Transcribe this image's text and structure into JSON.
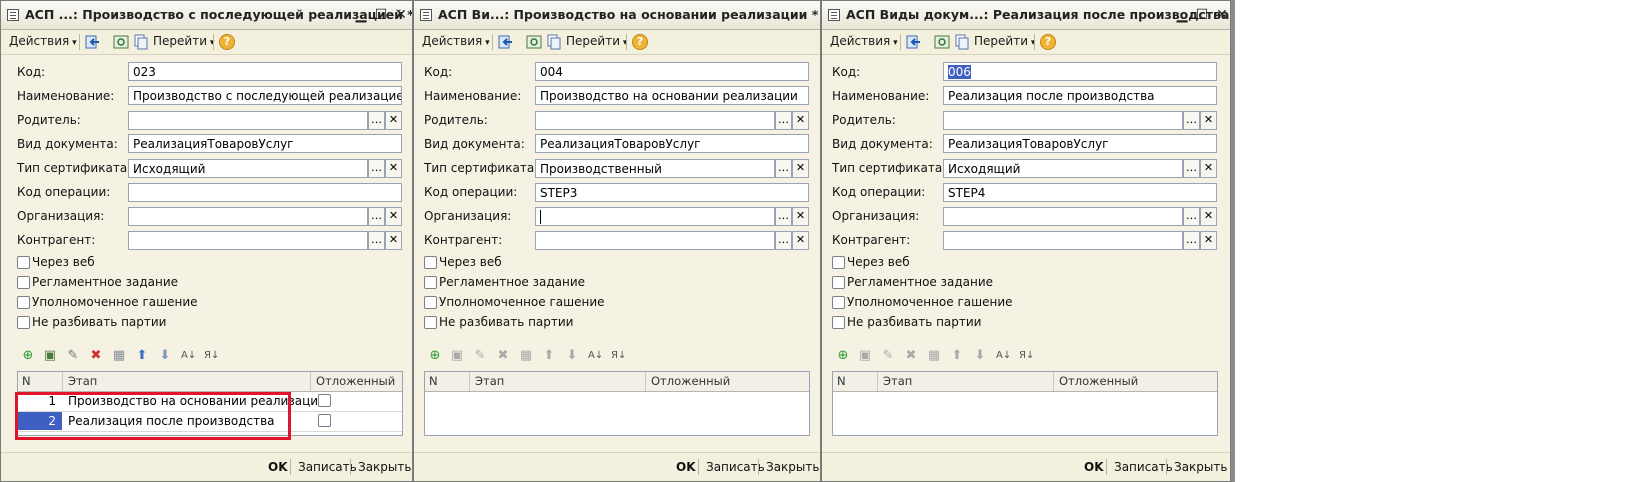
{
  "toolbar": {
    "actions_label": "Действия",
    "goto_label": "Перейти",
    "help_label": "?"
  },
  "labels": {
    "code": "Код:",
    "name": "Наименование:",
    "parent": "Родитель:",
    "doc_type": "Вид документа:",
    "cert_type": "Тип сертификата:",
    "op_code": "Код операции:",
    "org": "Организация:",
    "counterparty": "Контрагент:",
    "via_web": "Через веб",
    "scheduled": "Регламентное задание",
    "authorized": "Уполномоченное гашение",
    "no_split": "Не разбивать партии"
  },
  "grid_headers": {
    "n": "N",
    "stage": "Этап",
    "deferred": "Отложенный"
  },
  "buttons": {
    "ok": "OK",
    "save": "Записать",
    "close": "Закрыть"
  },
  "windows": [
    {
      "title": "АСП ...: Производство с последующей реализацией *",
      "code": "023",
      "name": "Производство с последующей реализацией",
      "parent": "",
      "doc_type": "РеализацияТоваровУслуг",
      "cert_type": "Исходящий",
      "op_code": "",
      "org": "",
      "counterparty": "",
      "rows": [
        {
          "n": "1",
          "stage": "Производство на основании реализации"
        },
        {
          "n": "2",
          "stage": "Реализация после производства"
        }
      ]
    },
    {
      "title": "АСП Ви...: Производство на основании реализации *",
      "code": "004",
      "name": "Производство на основании реализации",
      "parent": "",
      "doc_type": "РеализацияТоваровУслуг",
      "cert_type": "Производственный",
      "op_code": "STEP3",
      "org": "",
      "counterparty": "",
      "rows": []
    },
    {
      "title": "АСП Виды докум...: Реализация после производства",
      "code": "006",
      "name": "Реализация после производства",
      "parent": "",
      "doc_type": "РеализацияТоваровУслуг",
      "cert_type": "Исходящий",
      "op_code": "STEP4",
      "org": "",
      "counterparty": "",
      "rows": []
    }
  ]
}
